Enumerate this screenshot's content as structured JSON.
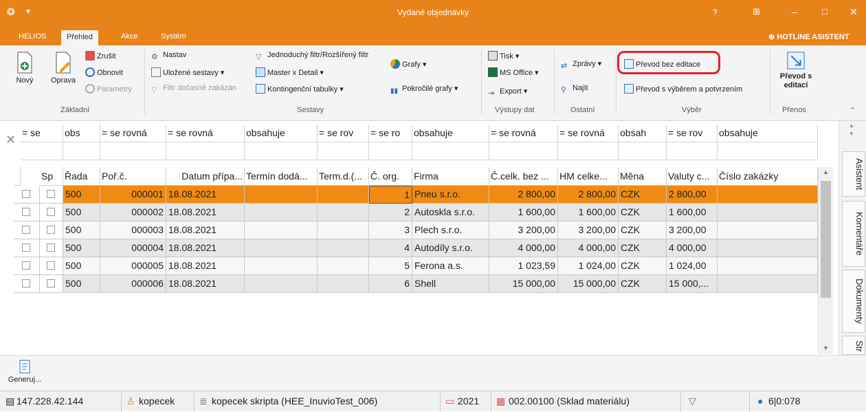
{
  "window": {
    "title": "Vydané objednávky",
    "help": "?"
  },
  "menu": {
    "items": [
      "HELIOS",
      "Přehled",
      "Akce",
      "Systém"
    ],
    "hotline": "HOTLINE ASISTENT"
  },
  "ribbon": {
    "zakladni": {
      "new": "Nový",
      "edit": "Oprava",
      "cancel": "Zrušit",
      "refresh": "Obnovit",
      "params": "Parametry",
      "group": "Základní"
    },
    "sestavy": {
      "setup": "Nastav",
      "saved": "Uložené sestavy",
      "filter_off": "Filtr dočasně zakázán",
      "simple_filter": "Jednoduchý filtr/Rozšířený filtr",
      "master_detail": "Master x Detail",
      "pivot": "Kontingenční tabulky",
      "charts": "Grafy",
      "adv_charts": "Pokročilé grafy",
      "group": "Sestavy"
    },
    "vystupy": {
      "print": "Tisk",
      "office": "MS Office",
      "export": "Export",
      "group": "Výstupy dat"
    },
    "ostatni": {
      "reports": "Zprávy",
      "find": "Najít",
      "group": "Ostatní"
    },
    "vyber": {
      "transfer_noedit": "Převod bez editace",
      "transfer_select": "Převod s výběrem a potvrzením",
      "group": "Výběr"
    },
    "prenos": {
      "transfer_edit": "Převod s editací",
      "group": "Přenos"
    }
  },
  "filters": [
    "= se",
    "obs",
    "= se rovná",
    "= se rovná",
    "obsahuje",
    "= se rov",
    "= se ro",
    "obsahuje",
    "= se rovná",
    "= se rovná",
    "obsah",
    "= se rov",
    "obsahuje"
  ],
  "columns": [
    "Sp",
    "Řada",
    "Poř.č.",
    "Datum přípa...",
    "Termín dodá...",
    "Term.d.(...",
    "Č. org.",
    "Firma",
    "Č.celk. bez ...",
    "HM celke...",
    "Měna",
    "Valuty c...",
    "Číslo zakázky"
  ],
  "rows": [
    {
      "rada": "500",
      "porc": "000001",
      "datum": "18.08.2021",
      "corg": "1",
      "firma": "Pneu s.r.o.",
      "celk": "2 800,00",
      "hm": "2 800,00",
      "mena": "CZK",
      "valuty": "2 800,00"
    },
    {
      "rada": "500",
      "porc": "000002",
      "datum": "18.08.2021",
      "corg": "2",
      "firma": "Autoskla s.r.o.",
      "celk": "1 600,00",
      "hm": "1 600,00",
      "mena": "CZK",
      "valuty": "1 600,00"
    },
    {
      "rada": "500",
      "porc": "000003",
      "datum": "18.08.2021",
      "corg": "3",
      "firma": "Plech s.r.o.",
      "celk": "3 200,00",
      "hm": "3 200,00",
      "mena": "CZK",
      "valuty": "3 200,00"
    },
    {
      "rada": "500",
      "porc": "000004",
      "datum": "18.08.2021",
      "corg": "4",
      "firma": "Autodíly s.r.o.",
      "celk": "4 000,00",
      "hm": "4 000,00",
      "mena": "CZK",
      "valuty": "4 000,00"
    },
    {
      "rada": "500",
      "porc": "000005",
      "datum": "18.08.2021",
      "corg": "5",
      "firma": "Ferona a.s.",
      "celk": "1 023,59",
      "hm": "1 024,00",
      "mena": "CZK",
      "valuty": "1 024,00"
    },
    {
      "rada": "500",
      "porc": "000006",
      "datum": "18.08.2021",
      "corg": "6",
      "firma": "Shell",
      "celk": "15 000,00",
      "hm": "15 000,00",
      "mena": "CZK",
      "valuty": "15 000,..."
    }
  ],
  "side_tabs": [
    "Asistent",
    "Komentáře",
    "Dokumenty",
    "Str"
  ],
  "bottom": {
    "generate": "Generuj..."
  },
  "status": {
    "ip": "147.228.42.144",
    "user": "kopecek",
    "db": "kopecek skripta (HEE_InuvioTest_006)",
    "year": "2021",
    "warehouse": "002.00100 (Sklad materiálu)",
    "info": "6|0:078"
  },
  "colors": {
    "accent": "#e8831a",
    "selected_row": "#f08a12",
    "highlight_ring": "#e4202a"
  }
}
